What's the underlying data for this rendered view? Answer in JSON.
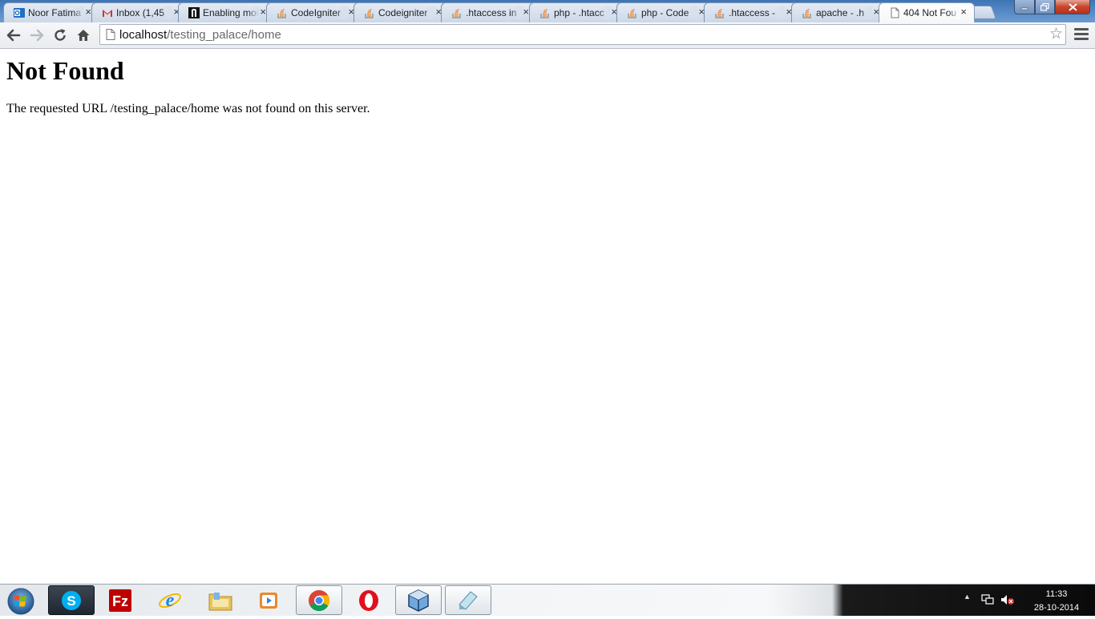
{
  "browser": {
    "tabs": [
      {
        "title": "Noor Fatima",
        "icon": "outlook-icon",
        "active": false
      },
      {
        "title": "Inbox (1,45",
        "icon": "gmail-icon",
        "active": false
      },
      {
        "title": "Enabling mod",
        "icon": "bookmark-icon",
        "active": false
      },
      {
        "title": "CodeIgniter",
        "icon": "stackoverflow-icon",
        "active": false
      },
      {
        "title": "Codeigniter",
        "icon": "stackoverflow-icon",
        "active": false
      },
      {
        "title": ".htaccess in",
        "icon": "stackoverflow-icon",
        "active": false
      },
      {
        "title": "php - .htacc",
        "icon": "stackoverflow-icon",
        "active": false
      },
      {
        "title": "php - Code",
        "icon": "stackoverflow-icon",
        "active": false
      },
      {
        "title": ".htaccess - ",
        "icon": "stackoverflow-icon",
        "active": false
      },
      {
        "title": "apache - .h",
        "icon": "stackoverflow-icon",
        "active": false
      },
      {
        "title": "404 Not Fou",
        "icon": "page-icon",
        "active": true
      }
    ],
    "tab_close_glyph": "×",
    "omnibox": {
      "host": "localhost",
      "path": "/testing_palace/home"
    }
  },
  "page": {
    "heading": "Not Found",
    "message": "The requested URL /testing_palace/home was not found on this server."
  },
  "taskbar": {
    "apps": [
      {
        "name": "skype",
        "open": false
      },
      {
        "name": "filezilla",
        "open": false
      },
      {
        "name": "internet-explorer",
        "open": false
      },
      {
        "name": "windows-explorer",
        "open": false
      },
      {
        "name": "media-player",
        "open": false
      },
      {
        "name": "chrome",
        "open": true
      },
      {
        "name": "opera",
        "open": false
      },
      {
        "name": "virtualbox",
        "open": true
      },
      {
        "name": "notepad",
        "open": true
      }
    ],
    "clock": {
      "time": "11:33",
      "date": "28-10-2014"
    }
  },
  "colors": {
    "titlebar": "#4a80c0",
    "close_button": "#c7452c",
    "url_host": "#111111",
    "url_path": "#6a6a6a"
  }
}
